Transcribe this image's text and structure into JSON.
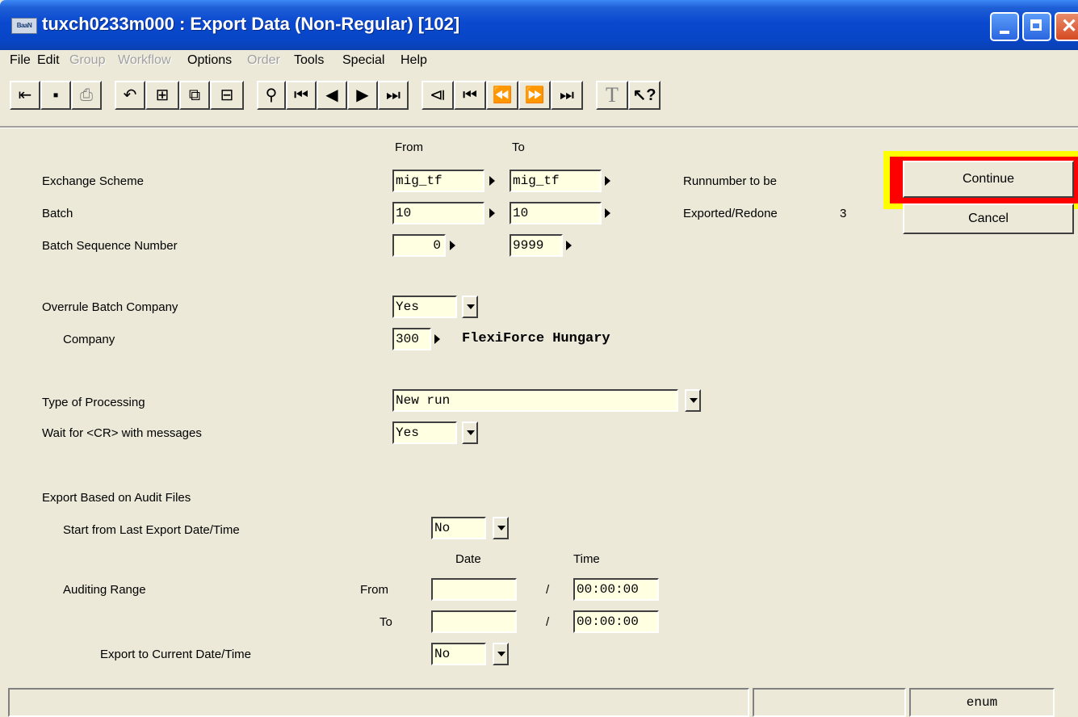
{
  "window": {
    "title": "tuxch0233m000 : Export Data (Non-Regular) [102]",
    "app_icon_text": "BaaN"
  },
  "menu": [
    {
      "label": "File",
      "enabled": true
    },
    {
      "label": "Edit",
      "enabled": true
    },
    {
      "label": "Group",
      "enabled": false
    },
    {
      "label": "Workflow",
      "enabled": false
    },
    {
      "label": "Options",
      "enabled": true
    },
    {
      "label": "Order",
      "enabled": false
    },
    {
      "label": "Tools",
      "enabled": true
    },
    {
      "label": "Special",
      "enabled": true
    },
    {
      "label": "Help",
      "enabled": true
    }
  ],
  "toolbar": {
    "icons": [
      "exit-icon",
      "save-icon",
      "print-icon",
      "undo-icon",
      "insert-record-icon",
      "copy-icon",
      "delete-record-icon",
      "find-icon",
      "first-record-icon",
      "previous-record-icon",
      "next-record-icon",
      "last-record-icon",
      "first-set-icon",
      "previous-set-icon",
      "previous-page-icon",
      "next-page-icon",
      "next-set-icon",
      "text-icon",
      "help-pointer-icon"
    ]
  },
  "form": {
    "col_from": "From",
    "col_to": "To",
    "exchange_scheme": {
      "label": "Exchange Scheme",
      "from": "mig_tf",
      "to": "mig_tf"
    },
    "batch": {
      "label": "Batch",
      "from": "10",
      "to": "10"
    },
    "batch_seq": {
      "label": "Batch Sequence Number",
      "from": "0",
      "to": "9999"
    },
    "runnumber_label": "Runnumber to be",
    "exported_label": "Exported/Redone",
    "exported_value": "3",
    "overrule_company": {
      "label": "Overrule Batch Company",
      "value": "Yes"
    },
    "company": {
      "label": "Company",
      "value": "300",
      "description": "FlexiForce Hungary"
    },
    "type_processing": {
      "label": "Type of Processing",
      "value": "New run"
    },
    "wait_cr": {
      "label": "Wait for <CR> with messages",
      "value": "Yes"
    },
    "audit_section_label": "Export Based on Audit Files",
    "start_last": {
      "label": "Start from Last Export Date/Time",
      "value": "No"
    },
    "col_date": "Date",
    "col_time": "Time",
    "auditing_range": {
      "label": "Auditing Range",
      "from_label": "From",
      "to_label": "To",
      "separator": "/",
      "from_date": "",
      "from_time": "00:00:00",
      "to_date": "",
      "to_time": "00:00:00"
    },
    "export_current": {
      "label": "Export to Current Date/Time",
      "value": "No"
    }
  },
  "buttons": {
    "continue": "Continue",
    "cancel": "Cancel"
  },
  "statusbar": {
    "message": "",
    "pane2": "",
    "pane3": "enum"
  },
  "colors": {
    "title_bar": "#0a48cf",
    "field_background": "#ffffe1",
    "window_background": "#ece9d8",
    "highlight_outer": "#ffff00",
    "highlight_inner": "#ff0000"
  }
}
